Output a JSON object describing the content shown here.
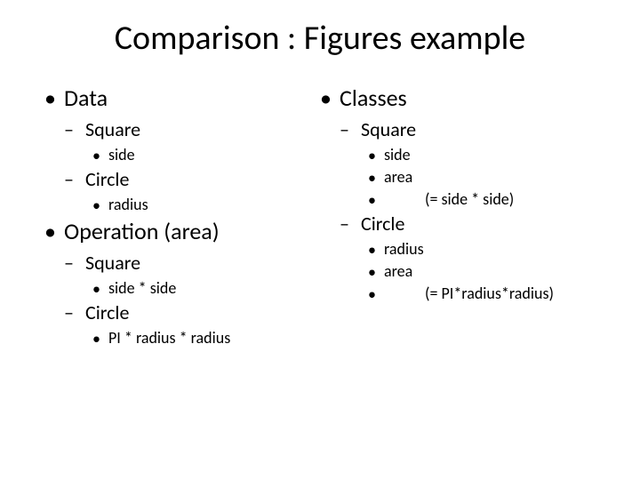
{
  "title": "Comparison : Figures example",
  "left": {
    "h1a": "Data",
    "h2a": "Square",
    "h3a": "side",
    "h2b": "Circle",
    "h3b": "radius",
    "h1b": "Operation (area)",
    "h2c": "Square",
    "h3c": "side * side",
    "h2d": "Circle",
    "h3d": "PI * radius * radius"
  },
  "right": {
    "h1a": "Classes",
    "h2a": "Square",
    "h3a": "side",
    "h3b": "area",
    "h3c": "(= side * side)",
    "h2b": "Circle",
    "h3d": "radius",
    "h3e": "area",
    "h3f": "(= PI*radius*radius)"
  }
}
